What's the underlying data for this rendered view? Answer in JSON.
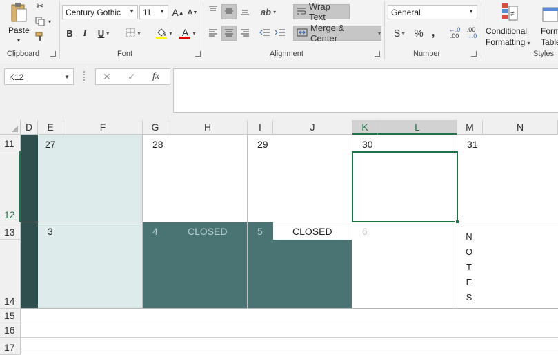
{
  "ribbon": {
    "groups": {
      "clipboard": "Clipboard",
      "font": "Font",
      "alignment": "Alignment",
      "number": "Number",
      "styles": "Styles"
    },
    "paste_label": "Paste",
    "font_name": "Century Gothic",
    "font_size": "11",
    "bold": "B",
    "italic": "I",
    "underline": "U",
    "grow_font": "A",
    "shrink_font": "A",
    "font_color_glyph": "A",
    "wrap_text": "Wrap Text",
    "merge_center": "Merge & Center",
    "number_format": "General",
    "currency": "$",
    "percent": "%",
    "comma": ",",
    "increase_decimal": ".00",
    "decrease_decimal": ".00",
    "conditional_formatting_l1": "Conditional",
    "conditional_formatting_l2": "Formatting",
    "format_table_l1": "Format as",
    "format_table_l2": "Table"
  },
  "formula_bar": {
    "name_box": "K12",
    "cancel": "✕",
    "enter": "✓",
    "fx": "fx",
    "formula": ""
  },
  "columns": [
    "D",
    "E",
    "F",
    "G",
    "H",
    "I",
    "J",
    "K",
    "L",
    "M",
    "N"
  ],
  "rows": [
    "11",
    "12",
    "13",
    "14",
    "15",
    "16",
    "17"
  ],
  "calendar": {
    "week1": [
      "27",
      "28",
      "29",
      "30",
      "31"
    ],
    "week2": [
      "3",
      "4",
      "5",
      "6"
    ],
    "closed_1": "CLOSED",
    "closed_2": "CLOSED",
    "notes": [
      "N",
      "O",
      "T",
      "E",
      "S"
    ]
  },
  "colors": {
    "accent": "#217346",
    "teal_dark": "#4a7474",
    "teal_light": "#deebeb",
    "stripe": "#2f4e4e"
  }
}
